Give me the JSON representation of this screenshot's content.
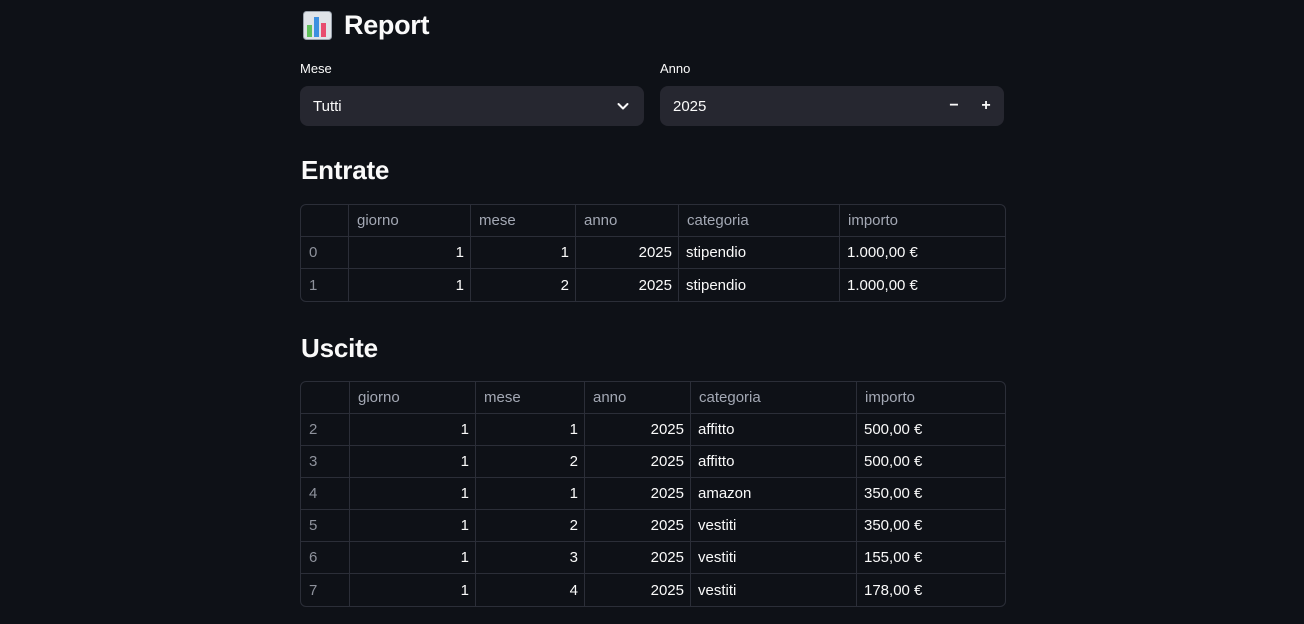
{
  "header": {
    "title": "Report",
    "icon": "bar-chart-icon"
  },
  "filters": {
    "month": {
      "label": "Mese",
      "selected": "Tutti"
    },
    "year": {
      "label": "Anno",
      "value": "2025",
      "decrement_label": "−",
      "increment_label": "+"
    }
  },
  "income": {
    "title": "Entrate",
    "columns": [
      "",
      "giorno",
      "mese",
      "anno",
      "categoria",
      "importo"
    ],
    "rows": [
      [
        "0",
        "1",
        "1",
        "2025",
        "stipendio",
        "1.000,00 €"
      ],
      [
        "1",
        "1",
        "2",
        "2025",
        "stipendio",
        "1.000,00 €"
      ]
    ]
  },
  "expenses": {
    "title": "Uscite",
    "columns": [
      "",
      "giorno",
      "mese",
      "anno",
      "categoria",
      "importo"
    ],
    "rows": [
      [
        "2",
        "1",
        "1",
        "2025",
        "affitto",
        "500,00 €"
      ],
      [
        "3",
        "1",
        "2",
        "2025",
        "affitto",
        "500,00 €"
      ],
      [
        "4",
        "1",
        "1",
        "2025",
        "amazon",
        "350,00 €"
      ],
      [
        "5",
        "1",
        "2",
        "2025",
        "vestiti",
        "350,00 €"
      ],
      [
        "6",
        "1",
        "3",
        "2025",
        "vestiti",
        "155,00 €"
      ],
      [
        "7",
        "1",
        "4",
        "2025",
        "vestiti",
        "178,00 €"
      ]
    ]
  },
  "colors": {
    "background": "#0e1117",
    "control_bg": "#262730",
    "border": "#2b2e38",
    "text": "#fafafa",
    "muted": "#a3a8b4"
  }
}
